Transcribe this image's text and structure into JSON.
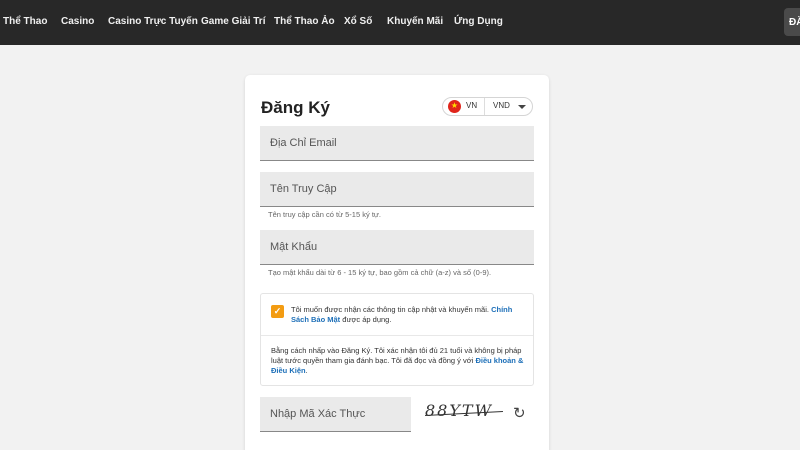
{
  "nav": {
    "items": [
      "Thể Thao",
      "Casino",
      "Casino Trực Tuyến",
      "Game Giải Trí",
      "Thể Thao Ảo",
      "Xổ Số",
      "Khuyến Mãi",
      "Ứng Dụng"
    ],
    "login_partial": "ĐĂ"
  },
  "form": {
    "title": "Đăng Ký",
    "locale": {
      "language": "VN",
      "currency": "VND",
      "flag_icon": "vietnam-flag-icon"
    },
    "email_placeholder": "Địa Chỉ Email",
    "username_placeholder": "Tên Truy Cập",
    "username_hint": "Tên truy cập cần có từ 5-15 ký tự.",
    "password_placeholder": "Mật Khẩu",
    "password_hint": "Tạo mật khẩu dài từ 6 - 15 ký tự, bao gồm cả chữ (a-z) và số (0-9).",
    "marketing_consent": {
      "checked": true,
      "text": "Tôi muốn được nhận các thông tin cập nhật và khuyến mãi.",
      "link": "Chính Sách Bảo Mật",
      "suffix": "được áp dụng."
    },
    "terms": {
      "text": "Bằng cách nhấp vào Đăng Ký. Tôi xác nhận tôi đủ 21 tuổi và không bị pháp luật tước quyền tham gia đánh bạc. Tôi đã đọc và đồng ý với",
      "link": "Điều khoản & Điều Kiện",
      "suffix": "."
    },
    "captcha_placeholder": "Nhập Mã Xác Thực",
    "captcha_code": "88YTW",
    "refresh_icon": "refresh-icon"
  },
  "colors": {
    "nav_bg": "#282828",
    "accent_orange": "#f39c12",
    "link_blue": "#1d6fb8",
    "page_bg": "#f2f2f2"
  }
}
